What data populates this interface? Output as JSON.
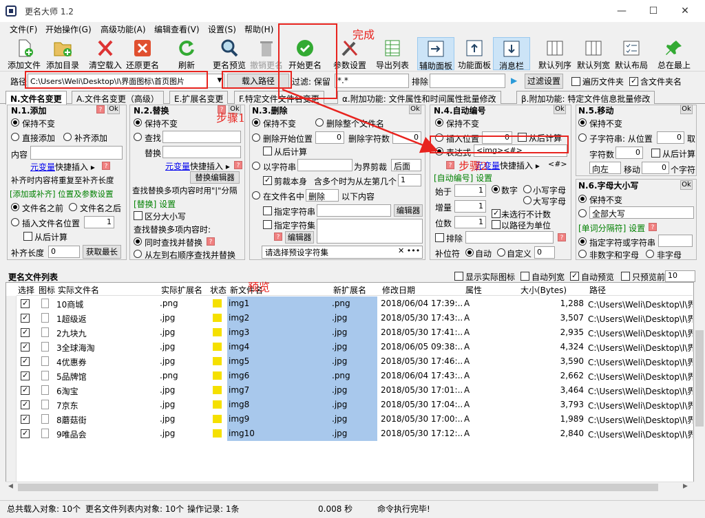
{
  "window": {
    "title": "更名大师 1.2",
    "min": "—",
    "max": "☐",
    "close": "✕"
  },
  "menu": [
    "文件(F)",
    "开始操作(G)",
    "高级功能(A)",
    "编辑查看(V)",
    "设置(S)",
    "帮助(H)"
  ],
  "toolbar": [
    "添加文件",
    "添加目录",
    "清空载入",
    "还原更名",
    "刷新",
    "更名预览",
    "撤销更名",
    "开始更名",
    "参数设置",
    "导出列表",
    "辅助面板",
    "功能面板",
    "消息栏",
    "默认列序",
    "默认列宽",
    "默认布局",
    "总在最上"
  ],
  "annotations": {
    "done": "完成",
    "step1": "步骤1",
    "step2": "步骤2",
    "preview": "预览"
  },
  "path": {
    "label": "路径",
    "value": "C:\\Users\\Weli\\Desktop\\l\\界面图标\\首页图片",
    "load": "载入路径",
    "filter_label": "过滤: 保留",
    "filter_value": "*.*",
    "exclude_label": "排除",
    "filter_btn": "过滤设置",
    "traverse": "遍历文件夹",
    "include_folder": "含文件夹名"
  },
  "tabs": [
    "N.文件名变更",
    "A.文件名变更（高级）",
    "E.扩展名变更",
    "F.特定文件文件名变更",
    "α.附加功能: 文件属性和时间属性批量修改",
    "β.附加功能: 特定文件信息批量修改"
  ],
  "p1": {
    "title": "N.1.添加",
    "ok": "Ok",
    "keep": "保持不变",
    "direct": "直接添加",
    "pad": "补齐添加",
    "content": "内容",
    "var": "元变量",
    "quick": "快捷插入 ▸",
    "note": "补齐时内容将重复至补齐长度",
    "sec": "[添加或补齐] 位置及参数设置",
    "before": "文件名之前",
    "after": "文件名之后",
    "insert": "插入文件名位置",
    "insert_val": "1",
    "from_back": "从后计算",
    "padlen": "补齐长度",
    "padlen_val": "0",
    "getmax": "获取最长"
  },
  "p2": {
    "title": "N.2.替换",
    "ok": "Ok",
    "keep": "保持不变",
    "find": "查找",
    "replace": "替换",
    "var": "元变量",
    "quick": "快捷插入 ▸",
    "editor": "替换编辑器",
    "note": "查找替换多项内容时用\"|\"分隔",
    "sec": "[替换] 设置",
    "case": "区分大小写",
    "multi": "查找替换多项内容时:",
    "same": "同时查找并替换",
    "l2r": "从左到右顺序查找并替换"
  },
  "p3": {
    "title": "N.3.删除",
    "ok": "Ok",
    "keep": "保持不变",
    "delall": "删除整个文件名",
    "delstart": "删除开始位置",
    "delstart_val": "0",
    "delcount": "删除字符数",
    "delcount_val": "0",
    "from_back": "从后计算",
    "bychar": "以字符串",
    "boundary": "为界剪裁",
    "after": "后面",
    "cutself": "剪裁本身",
    "multi": "含多个时为从左第几个",
    "multi_val": "1",
    "infile": "在文件名中",
    "del": "删除",
    "below": "以下内容",
    "specchar": "指定字符串",
    "editor": "编辑器",
    "specset": "指定字符集",
    "preset": "请选择预设字符集"
  },
  "p4": {
    "title": "N.4.自动编号",
    "ok": "Ok",
    "keep": "保持不变",
    "insert": "插入位置",
    "insert_val": "0",
    "from_back": "从后计算",
    "expr": "表达式",
    "expr_val": "<img><#>",
    "var": "元变量",
    "quick": "快捷插入 ▸",
    "code": "<#>",
    "sec": "[自动编号] 设置",
    "start": "始于",
    "start_val": "1",
    "digit": "数字",
    "lower": "小写字母",
    "step": "增量",
    "step_val": "1",
    "upper": "大写字母",
    "width": "位数",
    "width_val": "1",
    "skip": "未选行不计数",
    "pathunit": "以路径为单位",
    "exclude": "排除",
    "fill": "补位符",
    "auto": "自动",
    "custom": "自定义",
    "custom_val": "0"
  },
  "p5": {
    "title": "N.5.移动",
    "ok": "Ok",
    "keep": "保持不变",
    "substr": "子字符串: 从位置",
    "substr_val": "0",
    "take": "取",
    "count": "字符数",
    "count_val": "0",
    "from_back": "从后计算",
    "dir": "向左",
    "move": "移动",
    "move_val": "0",
    "unit": "个字符"
  },
  "p6": {
    "title": "N.6.字母大小写",
    "ok": "Ok",
    "keep": "保持不变",
    "allupper": "全部大写",
    "sec": "[单词分隔符] 设置",
    "spec": "指定字符或字符串",
    "nonalnum": "非数字和字母",
    "nonchar": "非字母"
  },
  "list": {
    "title": "更名文件列表",
    "show_icon": "显示实际图标",
    "auto_col": "自动列宽",
    "auto_prev": "自动预览",
    "prev_only": "只预览前",
    "prev_n": "10",
    "headers": [
      "选择",
      "图标",
      "实际文件名",
      "实际扩展名",
      "状态",
      "新文件名",
      "新扩展名",
      "修改日期",
      "属性",
      "大小(Bytes)",
      "路径"
    ],
    "rows": [
      {
        "name": "10商城",
        "ext": ".png",
        "new": "img1",
        "newext": ".png",
        "date": "2018/06/04 17:39:...",
        "attr": "A",
        "size": "1,288",
        "path": "C:\\Users\\Weli\\Desktop\\l\\界"
      },
      {
        "name": "1超级返",
        "ext": ".jpg",
        "new": "img2",
        "newext": ".jpg",
        "date": "2018/05/30 17:43:...",
        "attr": "A",
        "size": "3,507",
        "path": "C:\\Users\\Weli\\Desktop\\l\\界"
      },
      {
        "name": "2九块九",
        "ext": ".jpg",
        "new": "img3",
        "newext": ".jpg",
        "date": "2018/05/30 17:41:...",
        "attr": "A",
        "size": "2,935",
        "path": "C:\\Users\\Weli\\Desktop\\l\\界"
      },
      {
        "name": "3全球海淘",
        "ext": ".jpg",
        "new": "img4",
        "newext": ".jpg",
        "date": "2018/06/05 09:38:...",
        "attr": "A",
        "size": "4,324",
        "path": "C:\\Users\\Weli\\Desktop\\l\\界"
      },
      {
        "name": "4优惠券",
        "ext": ".jpg",
        "new": "img5",
        "newext": ".jpg",
        "date": "2018/05/30 17:46:...",
        "attr": "A",
        "size": "3,590",
        "path": "C:\\Users\\Weli\\Desktop\\l\\界"
      },
      {
        "name": "5品牌馆",
        "ext": ".png",
        "new": "img6",
        "newext": ".png",
        "date": "2018/06/04 17:43:...",
        "attr": "A",
        "size": "2,662",
        "path": "C:\\Users\\Weli\\Desktop\\l\\界"
      },
      {
        "name": "6淘宝",
        "ext": ".jpg",
        "new": "img7",
        "newext": ".jpg",
        "date": "2018/05/30 17:01:...",
        "attr": "A",
        "size": "3,464",
        "path": "C:\\Users\\Weli\\Desktop\\l\\界"
      },
      {
        "name": "7京东",
        "ext": ".jpg",
        "new": "img8",
        "newext": ".jpg",
        "date": "2018/05/30 17:04:...",
        "attr": "A",
        "size": "3,793",
        "path": "C:\\Users\\Weli\\Desktop\\l\\界"
      },
      {
        "name": "8蘑菇街",
        "ext": ".jpg",
        "new": "img9",
        "newext": ".jpg",
        "date": "2018/05/30 17:00:...",
        "attr": "A",
        "size": "1,989",
        "path": "C:\\Users\\Weli\\Desktop\\l\\界"
      },
      {
        "name": "9唯品会",
        "ext": ".jpg",
        "new": "img10",
        "newext": ".jpg",
        "date": "2018/05/30 17:12:...",
        "attr": "A",
        "size": "2,840",
        "path": "C:\\Users\\Weli\\Desktop\\l\\界"
      }
    ]
  },
  "status": {
    "total": "总共载入对象: 10个",
    "inlist": "更名文件列表内对象: 10个",
    "ops": "操作记录: 1条",
    "time": "0.008 秒",
    "msg": "命令执行完毕!"
  }
}
